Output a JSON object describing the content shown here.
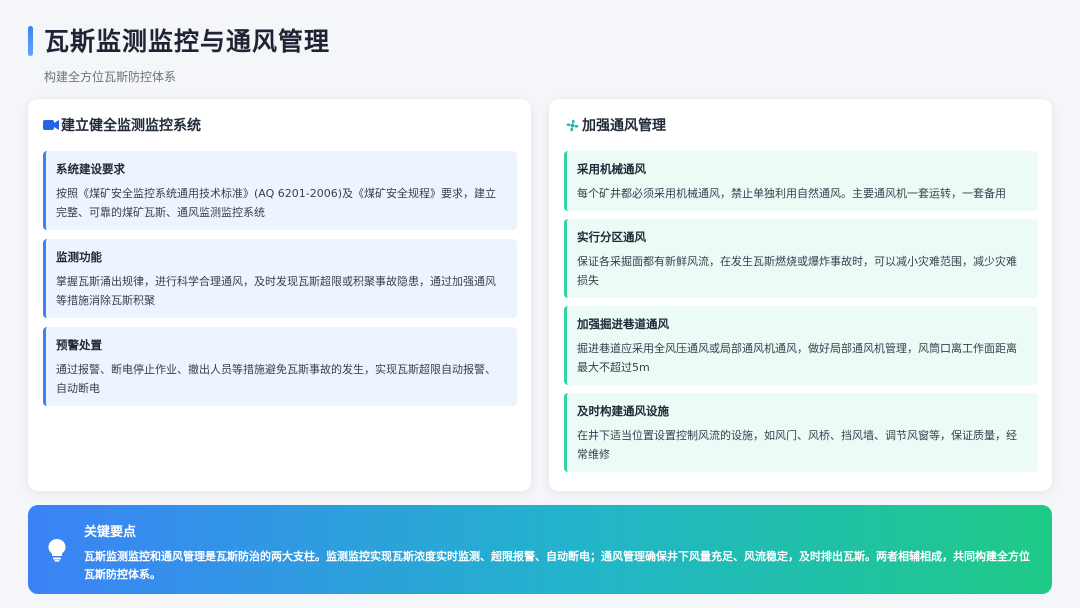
{
  "header": {
    "title": "瓦斯监测监控与通风管理",
    "subtitle": "构建全方位瓦斯防控体系"
  },
  "left_panel": {
    "icon": "video-camera-icon",
    "title": "建立健全监测监控系统",
    "cards": [
      {
        "title": "系统建设要求",
        "text": "按照《煤矿安全监控系统通用技术标准》(AQ 6201-2006)及《煤矿安全规程》要求，建立完整、可靠的煤矿瓦斯、通风监测监控系统"
      },
      {
        "title": "监测功能",
        "text": "掌握瓦斯涌出规律，进行科学合理通风，及时发现瓦斯超限或积聚事故隐患，通过加强通风等措施消除瓦斯积聚"
      },
      {
        "title": "预警处置",
        "text": "通过报警、断电停止作业、撤出人员等措施避免瓦斯事故的发生，实现瓦斯超限自动报警、自动断电"
      }
    ]
  },
  "right_panel": {
    "icon": "fan-icon",
    "title": "加强通风管理",
    "cards": [
      {
        "title": "采用机械通风",
        "text": "每个矿井都必须采用机械通风，禁止单独利用自然通风。主要通风机一套运转，一套备用"
      },
      {
        "title": "实行分区通风",
        "text": "保证各采掘面都有新鲜风流，在发生瓦斯燃烧或爆炸事故时，可以减小灾难范围，减少灾难损失"
      },
      {
        "title": "加强掘进巷道通风",
        "text": "掘进巷道应采用全风压通风或局部通风机通风，做好局部通风机管理，风筒口离工作面距离最大不超过5m"
      },
      {
        "title": "及时构建通风设施",
        "text": "在井下适当位置设置控制风流的设施，如风门、风桥、挡风墙、调节风窗等，保证质量，经常维修"
      }
    ]
  },
  "summary": {
    "icon": "lightbulb-icon",
    "title": "关键要点",
    "text": "瓦斯监测监控和通风管理是瓦斯防治的两大支柱。监测监控实现瓦斯浓度实时监测、超限报警、自动断电；通风管理确保井下风量充足、风流稳定，及时排出瓦斯。两者相辅相成，共同构建全方位瓦斯防控体系。"
  },
  "colors": {
    "accent_blue": "#3b82f6",
    "accent_green": "#2dd4a6",
    "card_blue_bg": "#eef4ff",
    "card_green_bg": "#ecfbf5"
  }
}
